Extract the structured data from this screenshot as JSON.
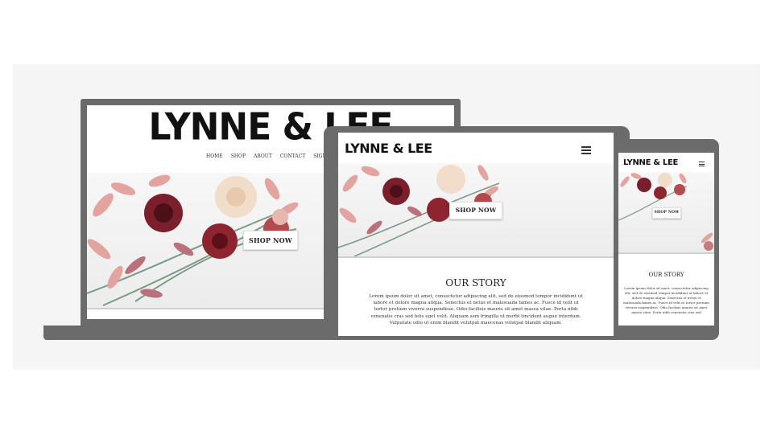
{
  "brand": "LYNNE & LEE",
  "laptop": {
    "nav": [
      "HOME",
      "SHOP",
      "ABOUT",
      "CONTACT",
      "SIGN IN"
    ],
    "cta": "SHOP NOW"
  },
  "tablet": {
    "cta": "SHOP NOW",
    "story_title": "OUR STORY",
    "story_text": "Lorem ipsum dolor sit amet, consectetur adipiscing elit, sed do eiusmod tempor incididunt ut labore et dolore magna aliqua. Senectus et netus et malesuada fames ac. Fusce id velit ut tortor pretium viverra suspendisse. Odio facilisis mauris sit amet massa vitae. Porta nibh venenatis cras sed felis eget velit. Aliquam sem fringilla ut morbi tincidunt augue interdum. Vulputate odio ut enim blandit volutpat maecenas volutpat blandit aliquam."
  },
  "phone": {
    "cta": "SHOP NOW",
    "story_title": "OUR STORY",
    "story_text": "Lorem ipsum dolor sit amet, consectetur adipiscing elit, sed do eiusmod tempor incididunt ut labore et dolore magna aliqua. Senectus et netus et malesuada fames ac. Fusce id velit ut tortor pretium viverra suspendisse. Odio facilisis mauris sit amet massa vitae. Porta nibh venenatis cras sed"
  },
  "icons": {
    "menu": "hamburger-menu-icon",
    "hero": "flower-arrangement-image"
  },
  "colors": {
    "device_frame": "#6b6b6b",
    "panel_bg": "#f5f5f5",
    "accent_deep": "#7a1f2b",
    "accent_blush": "#e9a8a0"
  }
}
